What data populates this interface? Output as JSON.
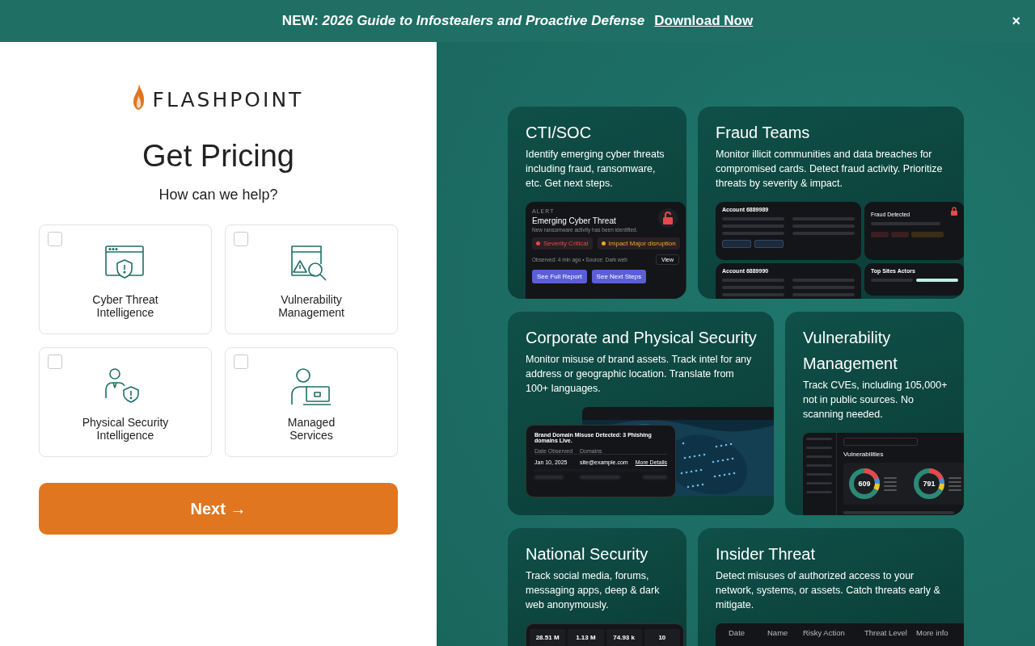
{
  "banner": {
    "prefix": "NEW:",
    "title": "2026 Guide to Infostealers and Proactive Defense",
    "link": "Download Now",
    "close": "×"
  },
  "logo": {
    "text": "FLASHPOINT"
  },
  "heading": "Get Pricing",
  "subheading": "How can we help?",
  "options": [
    {
      "label": "Cyber Threat Intelligence",
      "checked": false
    },
    {
      "label": "Vulnerability Management",
      "checked": false
    },
    {
      "label": "Physical Security Intelligence",
      "checked": false
    },
    {
      "label": "Managed Services",
      "checked": false
    }
  ],
  "next_button": "Next →",
  "cards": [
    {
      "title": "CTI/SOC",
      "description": "Identify emerging cyber threats including fraud, ransomware, etc. Get next steps.",
      "preview": {
        "kind": "alert",
        "label": "ALERT",
        "title": "Emerging Cyber Threat",
        "subtitle": "New ransomware activity has been identified.",
        "tags": [
          {
            "text": "Severity Critical",
            "color": "#e5484d"
          },
          {
            "text": "Impact Major disruption",
            "color": "#f5a524"
          }
        ],
        "meta": "Observed: 4 min ago • Source: Dark web",
        "view": "View",
        "buttons": [
          "See Full Report",
          "See Next Steps"
        ]
      }
    },
    {
      "title": "Fraud Teams",
      "description": "Monitor illicit communities and data breaches for compromised cards. Detect fraud activity. Prioritize threats by severity & impact.",
      "preview": {
        "kind": "fraud",
        "accounts": [
          "Account 6889989",
          "Account 6889990"
        ],
        "alert_title": "Fraud Detected",
        "panel_title": "Top Sites Actors"
      }
    },
    {
      "title": "Corporate and Physical Security",
      "description": "Monitor misuse of brand assets. Track intel for any address or geographic location. Translate from 100+ languages.",
      "preview": {
        "kind": "brand",
        "title": "Brand Domain Misuse Detected: 3 Phishing domains Live.",
        "columns": [
          "Date Observed",
          "Domains"
        ],
        "row": {
          "date": "Jan 10, 2025",
          "domain": "site@example.com",
          "link": "More Details"
        }
      }
    },
    {
      "title": "Vulnerability Management",
      "description": "Track CVEs, including 105,000+ not in public sources. No scanning needed.",
      "preview": {
        "kind": "vuln",
        "heading": "Vulnerabilities",
        "donuts": [
          {
            "value": "609"
          },
          {
            "value": "791"
          }
        ]
      }
    },
    {
      "title": "National Security",
      "description": "Track social media, forums, messaging apps, deep & dark web anonymously.",
      "preview": {
        "kind": "stats",
        "values": [
          "28.51 M",
          "1.13 M",
          "74.93 k",
          "10"
        ]
      }
    },
    {
      "title": "Insider Threat",
      "description": "Detect misuses of authorized access to your network, systems, or assets. Catch threats early & mitigate.",
      "preview": {
        "kind": "insider",
        "columns": [
          "Date",
          "Name",
          "Risky Action",
          "Threat Level",
          "More info"
        ]
      }
    }
  ]
}
